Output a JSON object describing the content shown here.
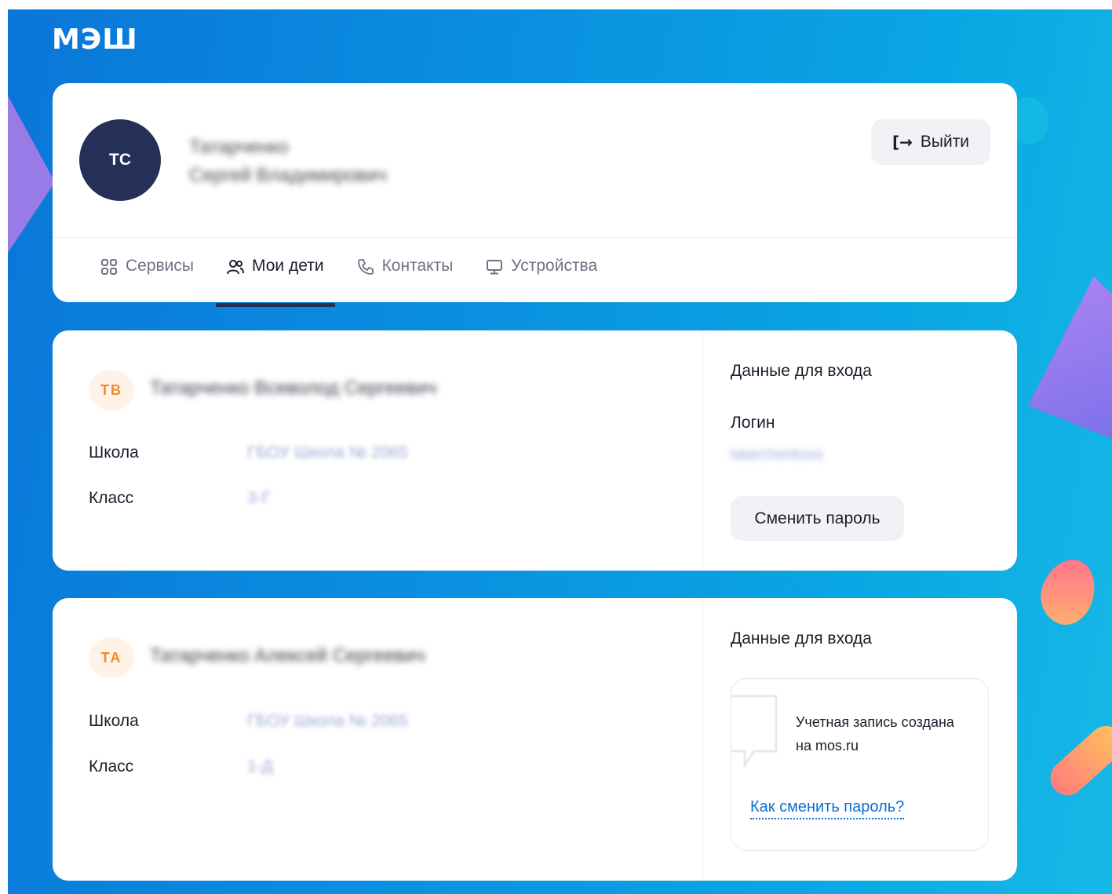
{
  "app": {
    "logo": "МЭШ"
  },
  "profile": {
    "initials": "ТС",
    "last_name": "Татарченко",
    "first_middle": "Сергей Владимирович",
    "logout_label": "Выйти"
  },
  "tabs": [
    {
      "label": "Сервисы",
      "icon": "grid-icon",
      "active": false
    },
    {
      "label": "Мои дети",
      "icon": "people-icon",
      "active": true
    },
    {
      "label": "Контакты",
      "icon": "phone-icon",
      "active": false
    },
    {
      "label": "Устройства",
      "icon": "monitor-icon",
      "active": false
    }
  ],
  "children": [
    {
      "initials": "ТВ",
      "name": "Татарченко Всеволод Сергеевич",
      "school_label": "Школа",
      "school_value": "ГБОУ Школа № 2065",
      "class_label": "Класс",
      "class_value": "3-Г",
      "login_section_title": "Данные для входа",
      "login_label": "Логин",
      "login_value": "tatarchenkovs",
      "change_password_label": "Сменить пароль"
    },
    {
      "initials": "ТА",
      "name": "Татарченко Алексей Сергеевич",
      "school_label": "Школа",
      "school_value": "ГБОУ Школа № 2065",
      "class_label": "Класс",
      "class_value": "1-Д",
      "login_section_title": "Данные для входа",
      "info_text": "Учетная запись создана на mos.ru",
      "info_link": "Как сменить пароль?"
    }
  ],
  "colors": {
    "background_gradient_start": "#0a76d8",
    "background_gradient_end": "#16b9e6",
    "avatar_dark": "#263056",
    "child_avatar_bg": "#fff2e7",
    "child_avatar_text": "#f08c2c",
    "link": "#0a6fd1",
    "button_bg": "#f1f2f5"
  }
}
